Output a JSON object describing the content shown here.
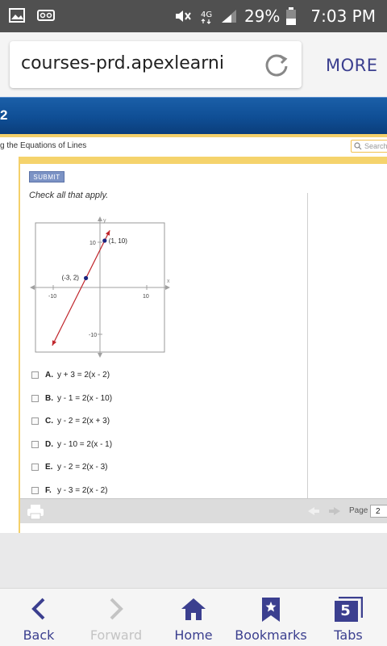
{
  "status_bar": {
    "battery": "29%",
    "time": "7:03 PM",
    "icons": [
      "image-icon",
      "voicemail-icon",
      "mute-icon",
      "4g-icon",
      "signal-icon",
      "battery-icon"
    ]
  },
  "browser": {
    "url": "courses-prd.apexlearni",
    "more_label": "MORE"
  },
  "site": {
    "header_number": "2",
    "lesson_title": "g the Equations of Lines",
    "search_placeholder": "Search"
  },
  "question": {
    "submit_label": "SUBMIT",
    "instruction": "Check all that apply.",
    "choices": [
      {
        "letter": "A.",
        "text": "y + 3 = 2(x - 2)"
      },
      {
        "letter": "B.",
        "text": "y - 1 = 2(x - 10)"
      },
      {
        "letter": "C.",
        "text": "y - 2 = 2(x + 3)"
      },
      {
        "letter": "D.",
        "text": "y - 10 = 2(x - 1)"
      },
      {
        "letter": "E.",
        "text": "y - 2 = 2(x - 3)"
      },
      {
        "letter": "F.",
        "text": "y - 3 = 2(x - 2)"
      }
    ]
  },
  "graph": {
    "x_axis_label": "x",
    "y_axis_label": "y",
    "tick_labels": {
      "x_neg": "-10",
      "x_pos": "10",
      "y_pos": "10",
      "y_neg": "-10"
    },
    "range": [
      -14,
      14
    ],
    "points": [
      {
        "x": 1,
        "y": 10,
        "label": "(1, 10)"
      },
      {
        "x": -3,
        "y": 2,
        "label": "(-3, 2)"
      }
    ],
    "line_color": "#c0272d",
    "point_color": "#1a237e"
  },
  "page_nav": {
    "page_label": "Page",
    "page_value": "2"
  },
  "bottom_nav": {
    "items": [
      {
        "label": "Back",
        "icon": "chevron-left-icon",
        "enabled": true
      },
      {
        "label": "Forward",
        "icon": "chevron-right-icon",
        "enabled": false
      },
      {
        "label": "Home",
        "icon": "home-icon",
        "enabled": true
      },
      {
        "label": "Bookmarks",
        "icon": "bookmark-icon",
        "enabled": true
      },
      {
        "label": "Tabs",
        "icon": "tabs-icon",
        "count": "5",
        "enabled": true
      }
    ]
  },
  "colors": {
    "accent": "#3b3f8f",
    "header_blue": "#0f4e95",
    "frame_yellow": "#f5d36c"
  }
}
